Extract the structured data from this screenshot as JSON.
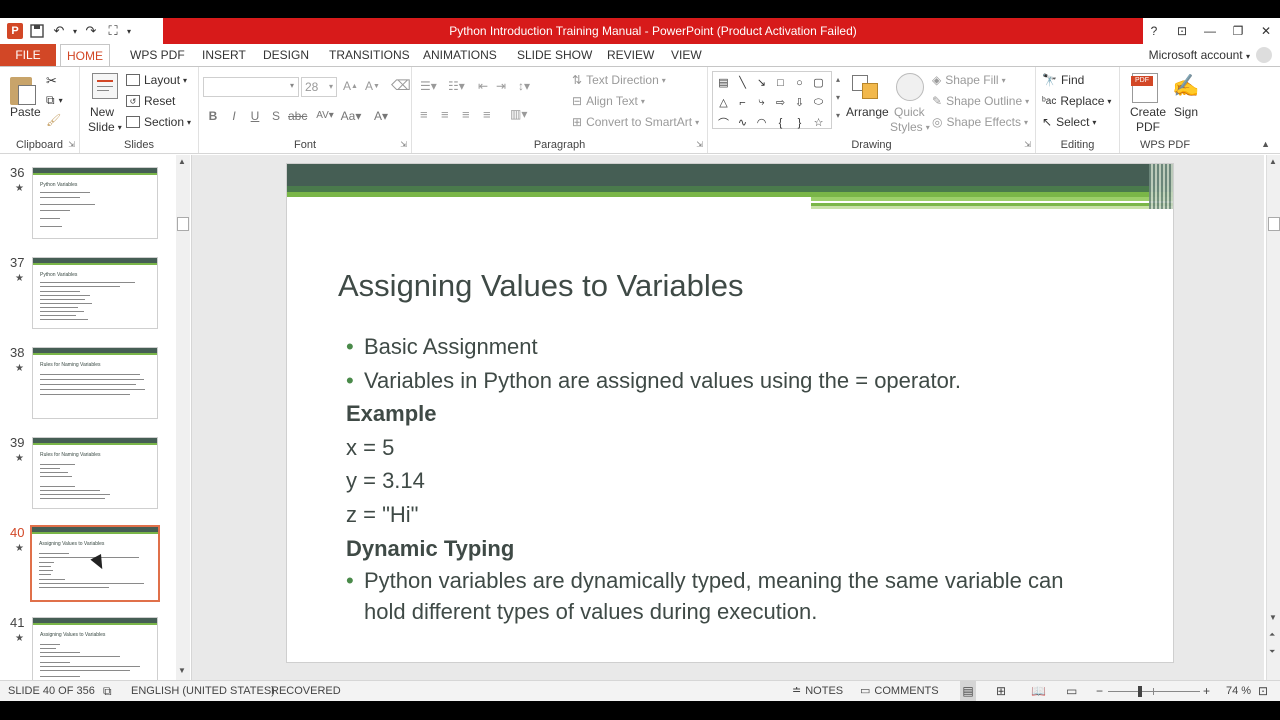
{
  "window": {
    "title": "Python Introduction Training Manual - PowerPoint (Product Activation Failed)",
    "help": "?",
    "qat": {
      "app_icon": "P"
    }
  },
  "ribbon_tabs": {
    "file": "FILE",
    "items": [
      "HOME",
      "WPS PDF",
      "INSERT",
      "DESIGN",
      "TRANSITIONS",
      "ANIMATIONS",
      "SLIDE SHOW",
      "REVIEW",
      "VIEW"
    ],
    "active": "HOME",
    "account": "Microsoft account"
  },
  "ribbon": {
    "clipboard": {
      "label": "Clipboard",
      "paste": "Paste"
    },
    "slides": {
      "label": "Slides",
      "new_slide_1": "New",
      "new_slide_2": "Slide",
      "layout": "Layout",
      "reset": "Reset",
      "section": "Section"
    },
    "font": {
      "label": "Font",
      "size": "28"
    },
    "paragraph": {
      "label": "Paragraph",
      "text_direction": "Text Direction",
      "align_text": "Align Text",
      "smartart": "Convert to SmartArt"
    },
    "drawing": {
      "label": "Drawing",
      "arrange": "Arrange",
      "quick_styles_1": "Quick",
      "quick_styles_2": "Styles",
      "shape_fill": "Shape Fill",
      "shape_outline": "Shape Outline",
      "shape_effects": "Shape Effects"
    },
    "editing": {
      "label": "Editing",
      "find": "Find",
      "replace": "Replace",
      "select": "Select"
    },
    "wps_pdf": {
      "label": "WPS PDF",
      "create_1": "Create",
      "create_2": "PDF",
      "sign": "Sign",
      "pdf_badge": "PDF"
    }
  },
  "thumbnails": [
    {
      "num": "36",
      "title": "Python Variables"
    },
    {
      "num": "37",
      "title": "Python Variables"
    },
    {
      "num": "38",
      "title": "Rules for Naming Variables"
    },
    {
      "num": "39",
      "title": "Rules for Naming Variables"
    },
    {
      "num": "40",
      "title": "Assigning Values to Variables",
      "selected": true
    },
    {
      "num": "41",
      "title": "Assigning Values to Variables"
    }
  ],
  "slide": {
    "title": "Assigning Values to Variables",
    "bullet1": "Basic Assignment",
    "bullet2": "Variables in Python are assigned values using the = operator.",
    "example_heading": "Example",
    "code1": "x = 5",
    "code2": "y = 3.14",
    "code3": "z = \"Hi\"",
    "dynamic_heading": "Dynamic Typing",
    "bullet3_line1": "Python variables are dynamically typed, meaning the same variable can",
    "bullet3_line2": "hold different types of values during execution."
  },
  "status": {
    "slide_info": "SLIDE 40 OF 356",
    "language": "ENGLISH (UNITED STATES)",
    "recovered": "RECOVERED",
    "notes": "NOTES",
    "comments": "COMMENTS",
    "zoom_minus": "−",
    "zoom_plus": "+",
    "zoom": "74 %"
  }
}
